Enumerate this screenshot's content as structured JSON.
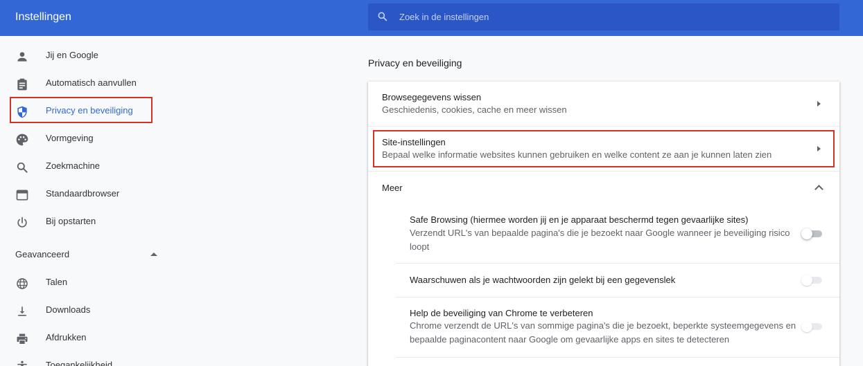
{
  "header": {
    "title": "Instellingen",
    "search_placeholder": "Zoek in de instellingen"
  },
  "sidebar": {
    "items": [
      {
        "label": "Jij en Google",
        "icon": "person-icon"
      },
      {
        "label": "Automatisch aanvullen",
        "icon": "clipboard-icon"
      },
      {
        "label": "Privacy en beveiliging",
        "icon": "shield-icon",
        "active": true
      },
      {
        "label": "Vormgeving",
        "icon": "palette-icon"
      },
      {
        "label": "Zoekmachine",
        "icon": "search-icon"
      },
      {
        "label": "Standaardbrowser",
        "icon": "browser-window-icon"
      },
      {
        "label": "Bij opstarten",
        "icon": "power-icon"
      }
    ],
    "advanced_label": "Geavanceerd",
    "advanced_items": [
      {
        "label": "Talen",
        "icon": "globe-icon"
      },
      {
        "label": "Downloads",
        "icon": "download-icon"
      },
      {
        "label": "Afdrukken",
        "icon": "printer-icon"
      },
      {
        "label": "Toegankelijkheid",
        "icon": "accessibility-icon"
      }
    ]
  },
  "main": {
    "section_title": "Privacy en beveiliging",
    "rows": [
      {
        "title": "Browsegegevens wissen",
        "subtitle": "Geschiedenis, cookies, cache en meer wissen"
      },
      {
        "title": "Site-instellingen",
        "subtitle": "Bepaal welke informatie websites kunnen gebruiken en welke content ze aan je kunnen laten zien"
      }
    ],
    "more_label": "Meer",
    "more_items": [
      {
        "title": "Safe Browsing (hiermee worden jij en je apparaat beschermd tegen gevaarlijke sites)",
        "subtitle_line1": "Verzendt URL's van bepaalde pagina's die je bezoekt naar Google wanneer je beveiliging risico",
        "subtitle_line2": "loopt",
        "enabled": false
      },
      {
        "title": "Waarschuwen als je wachtwoorden zijn gelekt bij een gegevenslek",
        "enabled": false,
        "disabled": true
      },
      {
        "title": "Help de beveiliging van Chrome te verbeteren",
        "subtitle_line1": "Chrome verzendt de URL's van sommige pagina's die je bezoekt, beperkte systeemgegevens en",
        "subtitle_line2": "bepaalde paginacontent naar Google om gevaarlijke apps en sites te detecteren",
        "enabled": false,
        "disabled": true
      }
    ]
  },
  "colors": {
    "header": "#3367d6",
    "search_bg": "#2a56c6",
    "active": "#3367d6",
    "highlight": "#d93025"
  }
}
